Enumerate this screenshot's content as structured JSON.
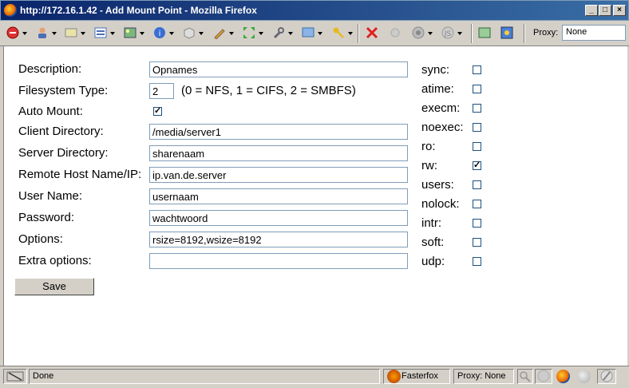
{
  "window": {
    "title": "http://172.16.1.42 - Add Mount Point - Mozilla Firefox",
    "minimize": "_",
    "maximize": "□",
    "close": "×"
  },
  "toolbar": {
    "proxy_label": "Proxy:",
    "proxy_value": "None",
    "icons": [
      "stop-red-icon",
      "user-icon",
      "mail-icon",
      "forms-icon",
      "image-icon",
      "info-icon",
      "package-icon",
      "pen-icon",
      "resize-icon",
      "wrench-icon",
      "screen-icon",
      "key-icon",
      "delete-x-icon",
      "circle-icon",
      "gauge-icon",
      "js-icon",
      "page-icon",
      "settings-icon"
    ]
  },
  "form": {
    "description_label": "Description:",
    "description_value": "Opnames",
    "fstype_label": "Filesystem Type:",
    "fstype_value": "2",
    "fstype_note": "(0 = NFS, 1 = CIFS, 2 = SMBFS)",
    "automount_label": "Auto Mount:",
    "automount_checked": true,
    "client_dir_label": "Client Directory:",
    "client_dir_value": "/media/server1",
    "server_dir_label": "Server Directory:",
    "server_dir_value": "sharenaam",
    "remote_host_label": "Remote Host Name/IP:",
    "remote_host_value": "ip.van.de.server",
    "username_label": "User Name:",
    "username_value": "usernaam",
    "password_label": "Password:",
    "password_value": "wachtwoord",
    "options_label": "Options:",
    "options_value": "rsize=8192,wsize=8192",
    "extra_options_label": "Extra options:",
    "extra_options_value": "",
    "save_label": "Save"
  },
  "mount_flags": [
    {
      "label": "sync:",
      "checked": false
    },
    {
      "label": "atime:",
      "checked": false
    },
    {
      "label": "execm:",
      "checked": false
    },
    {
      "label": "noexec:",
      "checked": false
    },
    {
      "label": "ro:",
      "checked": false
    },
    {
      "label": "rw:",
      "checked": true
    },
    {
      "label": "users:",
      "checked": false
    },
    {
      "label": "nolock:",
      "checked": false
    },
    {
      "label": "intr:",
      "checked": false
    },
    {
      "label": "soft:",
      "checked": false
    },
    {
      "label": "udp:",
      "checked": false
    }
  ],
  "statusbar": {
    "status": "Done",
    "fasterfox": "Fasterfox",
    "proxy": "Proxy: None"
  }
}
